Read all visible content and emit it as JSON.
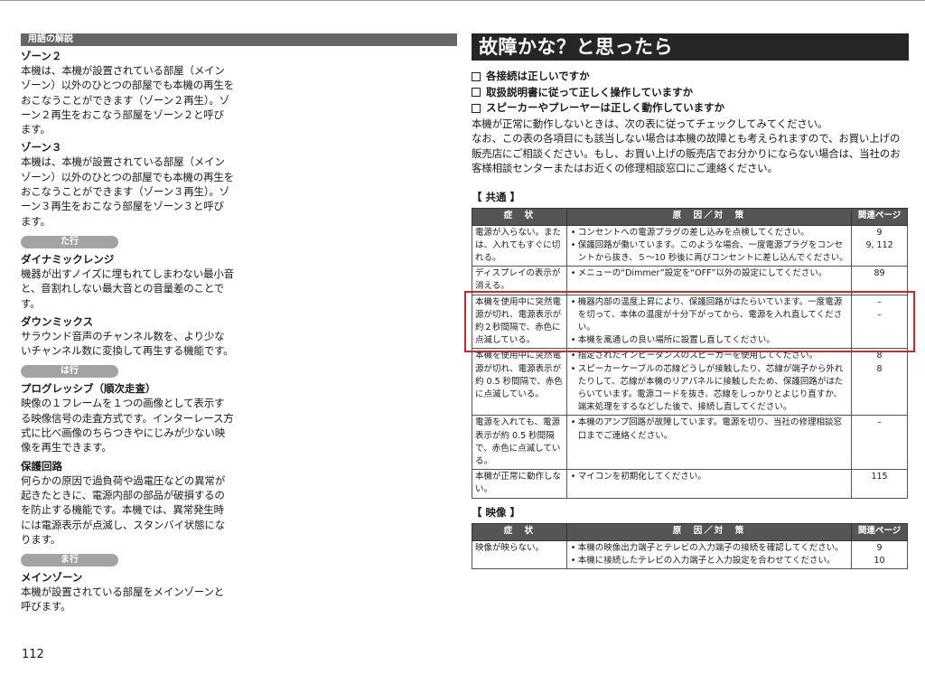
{
  "glossary": {
    "header": "用語の解説",
    "sections": [
      {
        "pill": "",
        "entries": [
          {
            "term": "ゾーン２",
            "desc": "本機は、本機が設置されている部屋（メインゾーン）以外のひとつの部屋でも本機の再生をおこなうことができます（ゾーン２再生）。ゾーン２再生をおこなう部屋をゾーン２と呼びます。"
          },
          {
            "term": "ゾーン３",
            "desc": "本機は、本機が設置されている部屋（メインゾーン）以外のひとつの部屋でも本機の再生をおこなうことができます（ゾーン３再生）。ゾーン３再生をおこなう部屋をゾーン３と呼びます。"
          }
        ]
      },
      {
        "pill": "た行",
        "entries": [
          {
            "term": "ダイナミックレンジ",
            "desc": "機器が出すノイズに埋もれてしまわない最小音と、音割れしない最大音との音量差のことです。"
          },
          {
            "term": "ダウンミックス",
            "desc": "サラウンド音声のチャンネル数を、より少ないチャンネル数に変換して再生する機能です。"
          }
        ]
      },
      {
        "pill": "は行",
        "entries": [
          {
            "term": "プログレッシブ（順次走査）",
            "desc": "映像の１フレームを１つの画像として表示する映像信号の走査方式です。インターレース方式に比べ画像のちらつきやにじみが少ない映像を再生できます。"
          },
          {
            "term": "保護回路",
            "desc": "何らかの原因で過負荷や過電圧などの異常が起きたときに、電源内部の部品が破損するのを防止する機能です。本機では、異常発生時には電源表示が点滅し、スタンバイ状態になります。"
          }
        ]
      },
      {
        "pill": "ま行",
        "entries": [
          {
            "term": "メインゾーン",
            "desc": "本機が設置されている部屋をメインゾーンと呼びます。"
          }
        ]
      }
    ],
    "page_number": "112"
  },
  "trouble": {
    "title": "故障かな？と思ったら",
    "checks": [
      "各接続は正しいですか",
      "取扱説明書に従って正しく操作していますか",
      "スピーカーやプレーヤーは正しく動作していますか"
    ],
    "intro": [
      "本機が正常に動作しないときは、次の表に従ってチェックしてみてください。",
      "なお、この表の各項目にも該当しない場合は本機の故障とも考えられますので、お買い上げの販売店にご相談ください。もし、お買い上げの販売店でお分かりにならない場合は、当社のお客様相談センターまたはお近くの修理相談窓口にご連絡ください。"
    ],
    "headers": {
      "state": "症　状",
      "cause": "原　因／対　策",
      "page": "関連ページ"
    },
    "general_label": "【 共通 】",
    "general_rows": [
      {
        "state": "電源が入らない。または、入れてもすぐに切れる。",
        "causes": [
          "コンセントへの電源プラグの差し込みを点検してください。",
          "保護回路が働いています。このような場合、一度電源プラグをコンセントから抜き、５～10 秒後に再びコンセントに差し込んでください。"
        ],
        "pages": [
          "9",
          "9, 112"
        ]
      },
      {
        "state": "ディスプレイの表示が消える。",
        "causes": [
          "メニューの“Dimmer”設定を“OFF”以外の設定にしてください。"
        ],
        "pages": [
          "89"
        ]
      },
      {
        "state": "本機を使用中に突然電源が切れ、電源表示が約２秒間隔で、赤色に点滅している。",
        "causes": [
          "機器内部の温度上昇により、保護回路がはたらいています。一度電源を切って、本体の温度が十分下がってから、電源を入れ直してください。",
          "本機を風通しの良い場所に設置し直してください。"
        ],
        "pages": [
          "–",
          "–"
        ]
      },
      {
        "state": "本機を使用中に突然電源が切れ、電源表示が約 0.5 秒間隔で、赤色に点滅している。",
        "causes": [
          "指定されたインピーダンスのスピーカーを使用してください。",
          "スピーカーケーブルの芯線どうしが接触したり、芯線が端子から外れたりして、芯線が本機のリアパネルに接触したため、保護回路がはたらいています。電源コードを抜き、芯線をしっかりとよじり直すか、端末処理をするなどした後で、接続し直してください。"
        ],
        "pages": [
          "8",
          "8"
        ]
      },
      {
        "state": "電源を入れても、電源表示が約 0.5 秒間隔で、赤色に点滅している。",
        "causes": [
          "本機のアンプ回路が故障しています。電源を切り、当社の修理相談窓口までご連絡ください。"
        ],
        "pages": [
          "–"
        ]
      },
      {
        "state": "本機が正常に動作しない。",
        "causes": [
          "マイコンを初期化してください。"
        ],
        "pages": [
          "115"
        ]
      }
    ],
    "video_label": "【 映像 】",
    "video_rows": [
      {
        "state": "映像が映らない。",
        "causes": [
          "本機の映像出力端子とテレビの入力端子の接続を確認してください。",
          "本機に接続したテレビの入力端子と入力設定を合わせてください。"
        ],
        "pages": [
          "9",
          "10"
        ]
      }
    ],
    "highlight_color": "#cc2a2a"
  }
}
